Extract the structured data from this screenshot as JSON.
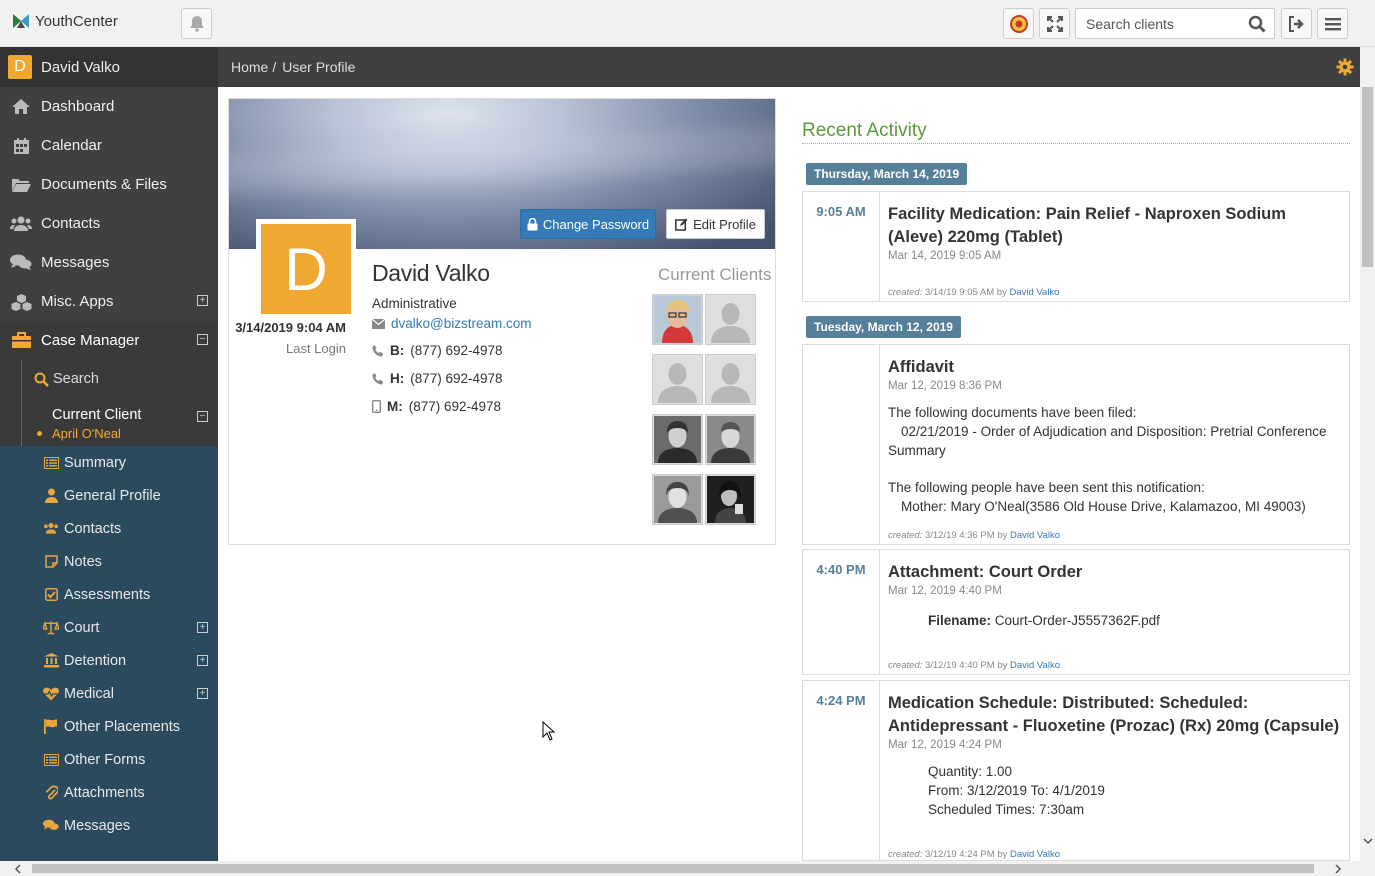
{
  "app": {
    "name": "YouthCenter",
    "search_placeholder": "Search clients"
  },
  "sidebar": {
    "user_initial": "D",
    "user_name": "David Valko",
    "items": [
      {
        "label": "Dashboard",
        "icon": "home-icon"
      },
      {
        "label": "Calendar",
        "icon": "calendar-icon"
      },
      {
        "label": "Documents & Files",
        "icon": "folder-icon"
      },
      {
        "label": "Contacts",
        "icon": "users-icon"
      },
      {
        "label": "Messages",
        "icon": "comments-icon"
      },
      {
        "label": "Misc. Apps",
        "icon": "cubes-icon",
        "expand": "+"
      },
      {
        "label": "Case Manager",
        "icon": "briefcase-icon",
        "expand": "−"
      }
    ],
    "case_manager": {
      "search_label": "Search",
      "current_client_label": "Current Client",
      "current_client_name": "April O'Neal",
      "client_items": [
        {
          "label": "Summary",
          "icon": "list-icon"
        },
        {
          "label": "General Profile",
          "icon": "user-icon"
        },
        {
          "label": "Contacts",
          "icon": "users-icon"
        },
        {
          "label": "Notes",
          "icon": "note-icon"
        },
        {
          "label": "Assessments",
          "icon": "checkbox-icon"
        },
        {
          "label": "Court",
          "icon": "scales-icon",
          "expand": "+"
        },
        {
          "label": "Detention",
          "icon": "building-icon",
          "expand": "+"
        },
        {
          "label": "Medical",
          "icon": "heartbeat-icon",
          "expand": "+"
        },
        {
          "label": "Other Placements",
          "icon": "flag-icon"
        },
        {
          "label": "Other Forms",
          "icon": "list-icon"
        },
        {
          "label": "Attachments",
          "icon": "paperclip-icon"
        },
        {
          "label": "Messages",
          "icon": "comments-icon"
        }
      ]
    }
  },
  "breadcrumb": {
    "home": "Home",
    "separator": "/",
    "current": "User Profile"
  },
  "profile": {
    "initial": "D",
    "first_name": "David",
    "last_name": "Valko",
    "role": "Administrative",
    "email": "dvalko@bizstream.com",
    "phones": [
      {
        "label": "B:",
        "value": "(877) 692-4978"
      },
      {
        "label": "H:",
        "value": "(877) 692-4978"
      },
      {
        "label": "M:",
        "value": "(877) 692-4978"
      }
    ],
    "last_login_date": "3/14/2019 9:04 AM",
    "last_login_label": "Last Login",
    "change_password_label": "Change Password",
    "edit_profile_label": "Edit Profile",
    "current_clients_title": "Current Clients"
  },
  "activity": {
    "title": "Recent Activity",
    "dates": [
      "Thursday, March 14, 2019",
      "Tuesday, March 12, 2019"
    ],
    "entries": [
      {
        "time": "9:05 AM",
        "title": "Facility Medication: Pain Relief - Naproxen Sodium (Aleve) 220mg (Tablet)",
        "sub": "Mar 14, 2019 9:05 AM",
        "created_prefix": "created:",
        "created_when": "3/14/19 9:05 AM by",
        "created_by": "David Valko"
      },
      {
        "time": "",
        "title": "Affidavit",
        "sub": "Mar 12, 2019 8:36 PM",
        "lines": [
          "The following documents have been filed:",
          "02/21/2019 - Order of Adjudication and Disposition: Pretrial Conference Summary",
          "The following people have been sent this notification:",
          "Mother: Mary O'Neal(3586 Old House Drive, Kalamazoo, MI 49003)"
        ],
        "created_prefix": "created:",
        "created_when": "3/12/19 4:36 PM by",
        "created_by": "David Valko"
      },
      {
        "time": "4:40 PM",
        "title": "Attachment: Court Order",
        "sub": "Mar 12, 2019 4:40 PM",
        "filename_label": "Filename:",
        "filename": "Court-Order-J5557362F.pdf",
        "created_prefix": "created:",
        "created_when": "3/12/19 4:40 PM by",
        "created_by": "David Valko"
      },
      {
        "time": "4:24 PM",
        "title": "Medication Schedule: Distributed: Scheduled: Antidepressant - Fluoxetine (Prozac) (Rx) 20mg (Capsule)",
        "sub": "Mar 12, 2019 4:24 PM",
        "lines": [
          "Quantity: 1.00",
          "From: 3/12/2019 To: 4/1/2019",
          "Scheduled Times: 7:30am"
        ],
        "created_prefix": "created:",
        "created_when": "3/12/19 4:24 PM by",
        "created_by": "David Valko"
      }
    ]
  },
  "colors": {
    "accent_orange": "#f0a830",
    "primary_blue": "#337ab7",
    "activity_green": "#5a9a3a",
    "badge_blue": "#56809a"
  }
}
